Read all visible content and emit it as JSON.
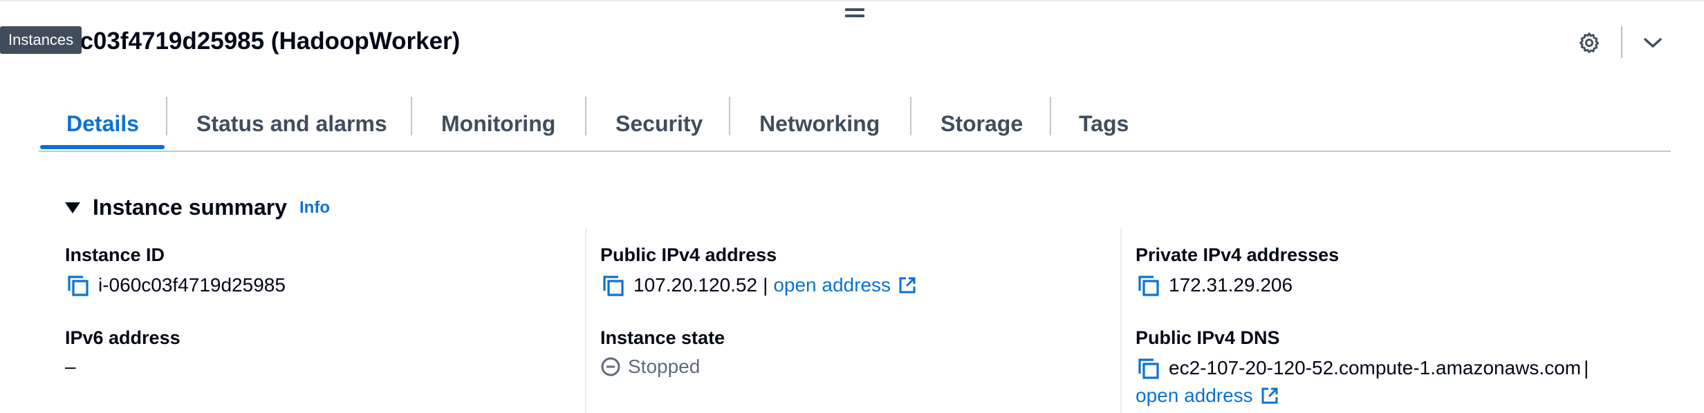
{
  "tooltip": {
    "text": "Instances"
  },
  "page": {
    "title": "0c03f4719d25985 (HadoopWorker)"
  },
  "tabs": [
    {
      "label": "Details",
      "active": true
    },
    {
      "label": "Status and alarms"
    },
    {
      "label": "Monitoring"
    },
    {
      "label": "Security"
    },
    {
      "label": "Networking"
    },
    {
      "label": "Storage"
    },
    {
      "label": "Tags"
    }
  ],
  "summary": {
    "title": "Instance summary",
    "info_label": "Info",
    "instance_id": {
      "label": "Instance ID",
      "value": "i-060c03f4719d25985"
    },
    "ipv6": {
      "label": "IPv6 address",
      "value": "–"
    },
    "public_ipv4": {
      "label": "Public IPv4 address",
      "value": "107.20.120.52",
      "separator": "|",
      "link": "open address"
    },
    "instance_state": {
      "label": "Instance state",
      "value": "Stopped"
    },
    "private_ipv4": {
      "label": "Private IPv4 addresses",
      "value": "172.31.29.206"
    },
    "public_dns": {
      "label": "Public IPv4 DNS",
      "value": "ec2-107-20-120-52.compute-1.amazonaws.com",
      "separator": "|",
      "link": "open address"
    }
  },
  "colors": {
    "accent": "#0972d3",
    "text": "#000716",
    "muted": "#5f6b7a"
  },
  "icons": [
    "drag-handle-icon",
    "settings-gear-icon",
    "chevron-down-icon",
    "caret-down-icon",
    "copy-icon",
    "external-link-icon",
    "stopped-status-icon"
  ]
}
